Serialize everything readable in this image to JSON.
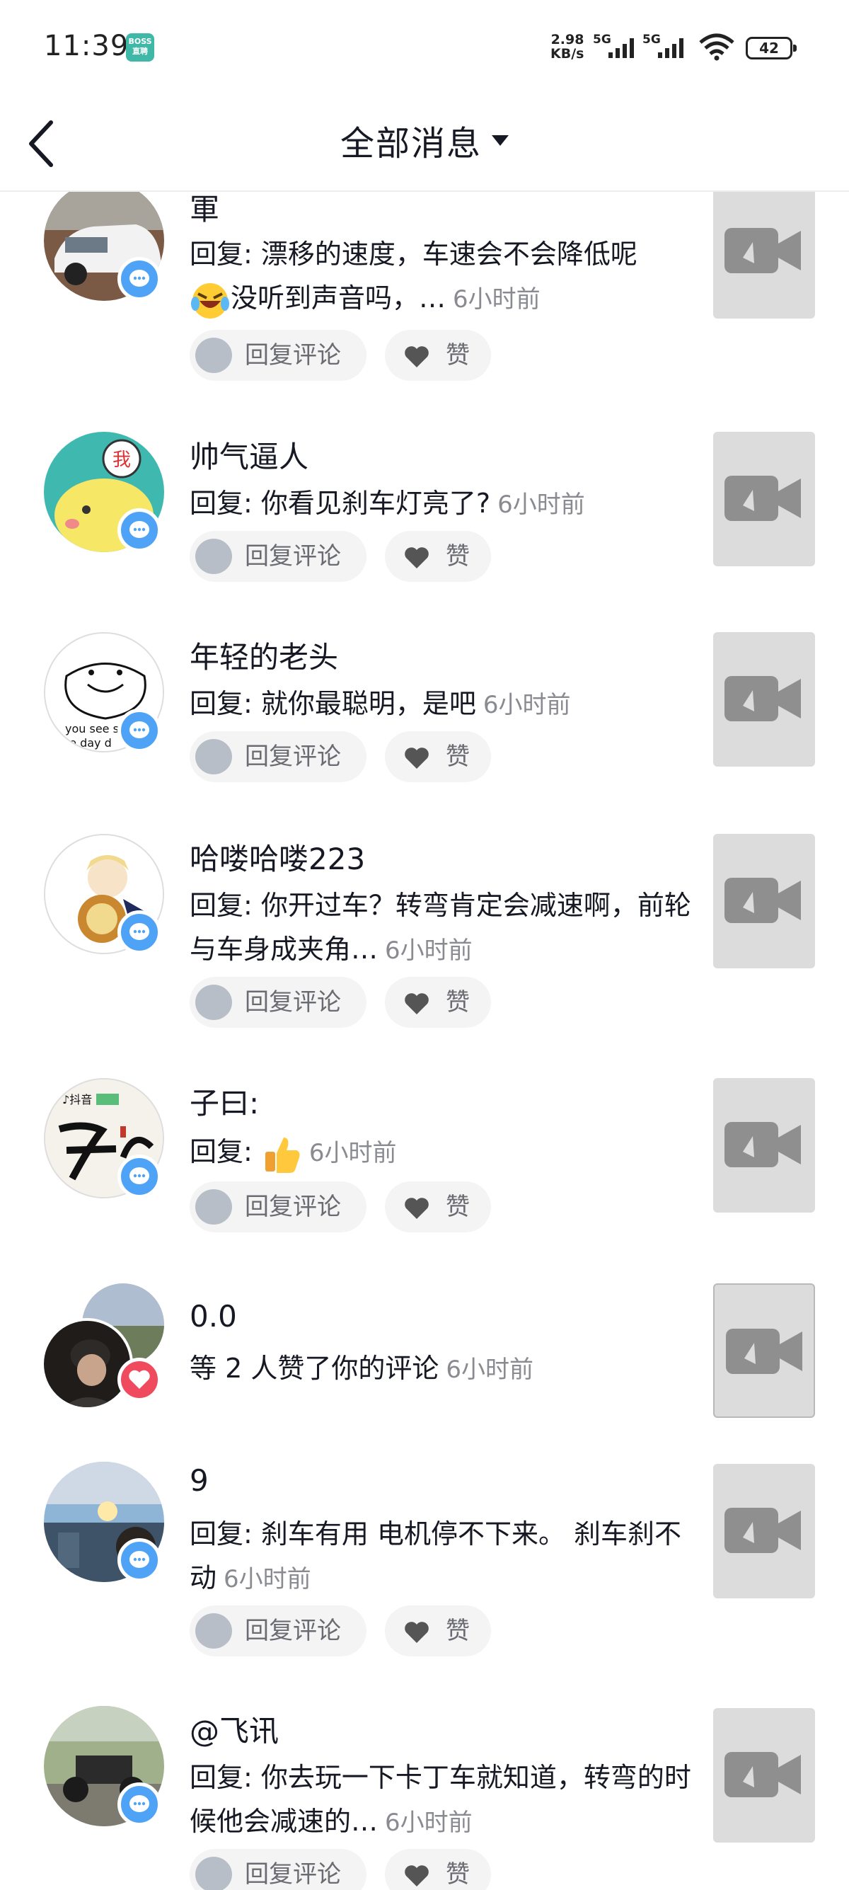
{
  "status_bar": {
    "time": "11:39",
    "app_badge_top": "BOSS",
    "app_badge_bottom": "直聘",
    "net_speed_value": "2.98",
    "net_speed_unit": "KB/s",
    "sim1": "5G",
    "sim2": "5G",
    "battery": "42"
  },
  "header": {
    "title": "全部消息",
    "back_icon": "chevron-left-icon",
    "dropdown_icon": "caret-down-icon"
  },
  "actions": {
    "reply_label": "回复评论",
    "like_label": "赞"
  },
  "items": [
    {
      "name": "軍",
      "msg_text": "回复: 漂移的速度，车速会不会降低呢",
      "msg_text_line2": "没听到声音吗，…",
      "emoji": "laughing-crying-emoji",
      "time": "6小时前",
      "badge": "comment-icon"
    },
    {
      "name": "帅气逼人",
      "msg_text": "回复: 你看见刹车灯亮了?",
      "time": "6小时前",
      "badge": "comment-icon"
    },
    {
      "name": "年轻的老头",
      "msg_text": "回复: 就你最聪明，是吧",
      "time": "6小时前",
      "badge": "comment-icon"
    },
    {
      "name": "哈喽哈喽223",
      "msg_text": "回复: 你开过车？转弯肯定会减速啊，前轮与车身成夹角…",
      "time": "6小时前",
      "badge": "comment-icon"
    },
    {
      "name": "子曰:",
      "msg_text": "回复:",
      "emoji": "thumbs-up-emoji",
      "time": "6小时前",
      "badge": "comment-icon"
    },
    {
      "name": "0.0",
      "msg_text": "等 2 人赞了你的评论",
      "time": "6小时前",
      "badge": "heart-icon"
    },
    {
      "name": "9",
      "msg_text": "回复: 刹车有用  电机停不下来。 刹车刹不动",
      "time": "6小时前",
      "badge": "comment-icon"
    },
    {
      "name": "@飞讯",
      "msg_text": "回复: 你去玩一下卡丁车就知道，转弯的时候他会减速的…",
      "time": "6小时前",
      "badge": "comment-icon"
    }
  ],
  "colors": {
    "comment_badge": "#4fa3f7",
    "like_badge": "#f04a5f",
    "timestamp": "#8a8b91",
    "pill_bg": "#f4f4f5"
  }
}
